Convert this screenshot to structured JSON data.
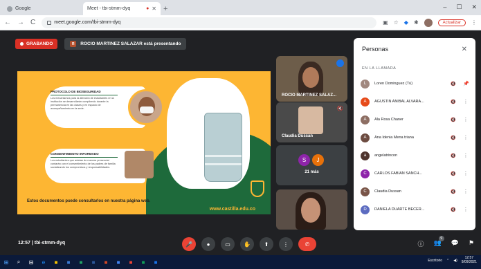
{
  "browser": {
    "tabs": [
      {
        "title": "Google",
        "active": false
      },
      {
        "title": "Meet - tbi-stmm-dyq",
        "active": true,
        "recording": "●"
      }
    ],
    "new_tab": "+",
    "window_controls": [
      "–",
      "☐",
      "✕"
    ],
    "url": "meet.google.com/tbi-stmm-dyq",
    "update_label": "Actualizar",
    "nav": {
      "back": "←",
      "forward": "→",
      "reload": "C"
    }
  },
  "meet": {
    "recording_label": "GRABANDO",
    "presenting_initial": "R",
    "presenting_text": "ROCIO MARTINEZ SALAZAR está presentando",
    "slide": {
      "card1_title": "PROTOCOLO DE BIOSEGURIDAD",
      "card1_body": "Los mecanismos para la atención de estudiantes en la institución se desarrollarán cumpliendo durante la permanencia en las clases y en espacio de acompañamiento en la sede.",
      "card2_title": "CONSENTIMIENTO INFORMADO",
      "card2_body": "Los estudiantes que asistan de manera presencial contarán con el consentimiento de los padres de familia socializando los compromisos y responsabilidades.",
      "footer": "Estos documentos puede consultarlos en nuestra página web.",
      "url": "www.castilla.edu.co"
    },
    "tiles": [
      {
        "name": "ROCIO MARTINEZ SALAZ..."
      },
      {
        "name": "Claudia Dussan"
      },
      {
        "more": "21 más",
        "avatars": [
          {
            "letter": "S",
            "color": "#8e24aa"
          },
          {
            "letter": "J",
            "color": "#e8710a"
          }
        ]
      },
      {
        "name": ""
      }
    ],
    "people_panel": {
      "title": "Personas",
      "close": "✕",
      "section": "EN LA LLAMADA",
      "people": [
        {
          "name": "Loren Dominguez (Tú)",
          "initial": "L",
          "color": "#a1887f",
          "mic": "🔇",
          "action": "📌"
        },
        {
          "name": "AGUSTIN ANIBAL ALVARA...",
          "initial": "A",
          "color": "#e64a19",
          "mic": "🔇",
          "action": "⋮"
        },
        {
          "name": "Ala Rosa Chaner",
          "initial": "A",
          "color": "#8d6e63",
          "mic": "🔇",
          "action": "⋮"
        },
        {
          "name": "Ana Idenia Mena triana",
          "initial": "A",
          "color": "#6d4c41",
          "mic": "🔇",
          "action": "⋮"
        },
        {
          "name": "angelatrincon",
          "initial": "a",
          "color": "#4e342e",
          "mic": "🔇",
          "action": "⋮"
        },
        {
          "name": "CARLOS FABIAN SANCH...",
          "initial": "C",
          "color": "#8e24aa",
          "mic": "🔇",
          "action": "⋮"
        },
        {
          "name": "Claudia Dussan",
          "initial": "C",
          "color": "#795548",
          "mic": "🔇",
          "action": "⋮"
        },
        {
          "name": "DANIELA DUARTE BECER...",
          "initial": "D",
          "color": "#5c6bc0",
          "mic": "🔇",
          "action": "⋮"
        }
      ]
    },
    "bottom": {
      "time": "12:57",
      "separator": "|",
      "meeting_code": "tbi-stmm-dyq",
      "controls": [
        "🎤",
        "●",
        "▭",
        "✋",
        "⬆",
        "⋮",
        "✆"
      ],
      "right": [
        "ⓘ",
        "👥",
        "💬",
        "⚑"
      ],
      "people_count": "9"
    }
  },
  "taskbar": {
    "start": "⊞",
    "search": "⌕",
    "apps": [
      {
        "icon": "⊟",
        "color": "#ffffff"
      },
      {
        "icon": "e",
        "color": "#1e90ff"
      },
      {
        "icon": "■",
        "color": "#f5c400"
      },
      {
        "icon": "■",
        "color": "#3a7bd5"
      },
      {
        "icon": "■",
        "color": "#21a366"
      },
      {
        "icon": "■",
        "color": "#2b579a"
      },
      {
        "icon": "■",
        "color": "#d24726"
      },
      {
        "icon": "■",
        "color": "#4285f4"
      },
      {
        "icon": "■",
        "color": "#ea4335"
      },
      {
        "icon": "■",
        "color": "#0f9d58"
      },
      {
        "icon": "■",
        "color": "#1a73e8"
      }
    ],
    "tray_text": "Escritorio",
    "clock_time": "12:57",
    "clock_date": "9/09/2021"
  }
}
